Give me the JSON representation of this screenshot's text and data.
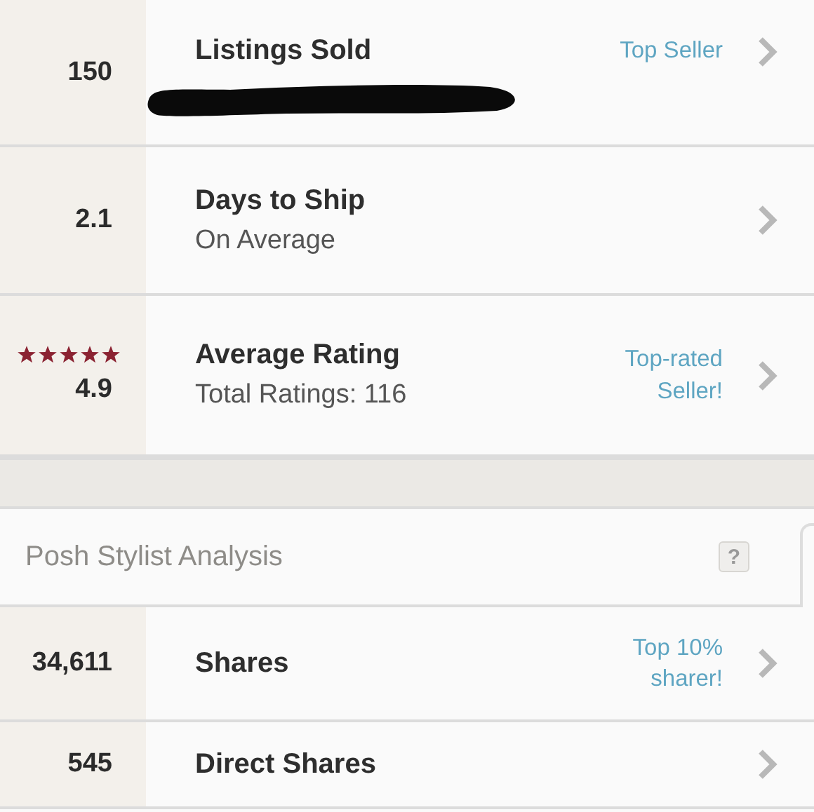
{
  "seller_stats": [
    {
      "value": "150",
      "title": "Listings Sold",
      "badge": "Top Seller",
      "redacted": true
    },
    {
      "value": "2.1",
      "title": "Days to Ship",
      "subtitle": "On Average",
      "redacted": false
    },
    {
      "value": "4.9",
      "stars": 5,
      "title": "Average Rating",
      "subtitle": "Total Ratings: 116",
      "badge": "Top-rated Seller!",
      "redacted": false
    }
  ],
  "stylist_analysis": {
    "title": "Posh Stylist Analysis",
    "help": "?",
    "rows": [
      {
        "value": "34,611",
        "title": "Shares",
        "badge": "Top 10% sharer!",
        "redacted": false
      },
      {
        "value": "545",
        "title": "Direct Shares",
        "redacted": false
      }
    ]
  }
}
